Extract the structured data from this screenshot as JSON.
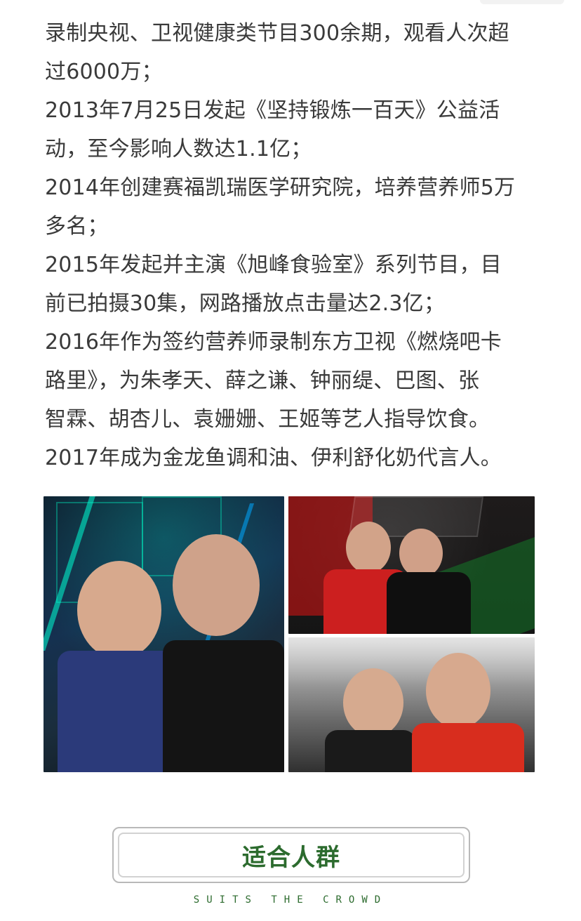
{
  "content": {
    "lines": [
      "录制央视、卫视健康类节目300余期，观看人次超",
      "过6000万；",
      "2013年7月25日发起《坚持锻炼一百天》公益活",
      "动，至今影响人数达1.1亿；",
      "2014年创建赛福凯瑞医学研究院，培养营养师5万",
      "多名；",
      "2015年发起并主演《旭峰食验室》系列节目，目",
      "前已拍摄30集，网路播放点击量达2.3亿；",
      "2016年作为签约营养师录制东方卫视《燃烧吧卡",
      "路里》，为朱孝天、薛之谦、钟丽缇、巴图、张",
      "智霖、胡杏儿、袁姗姗、王姬等艺人指导饮食。",
      "2017年成为金龙鱼调和油、伊利舒化奶代言人。"
    ]
  },
  "cta": {
    "label": "适合人群",
    "subtitle": "SUITS THE CROWD"
  },
  "colors": {
    "text": "#3a3a3a",
    "accent_green": "#2c6b2e",
    "border_gray": "#b9b9b9"
  }
}
